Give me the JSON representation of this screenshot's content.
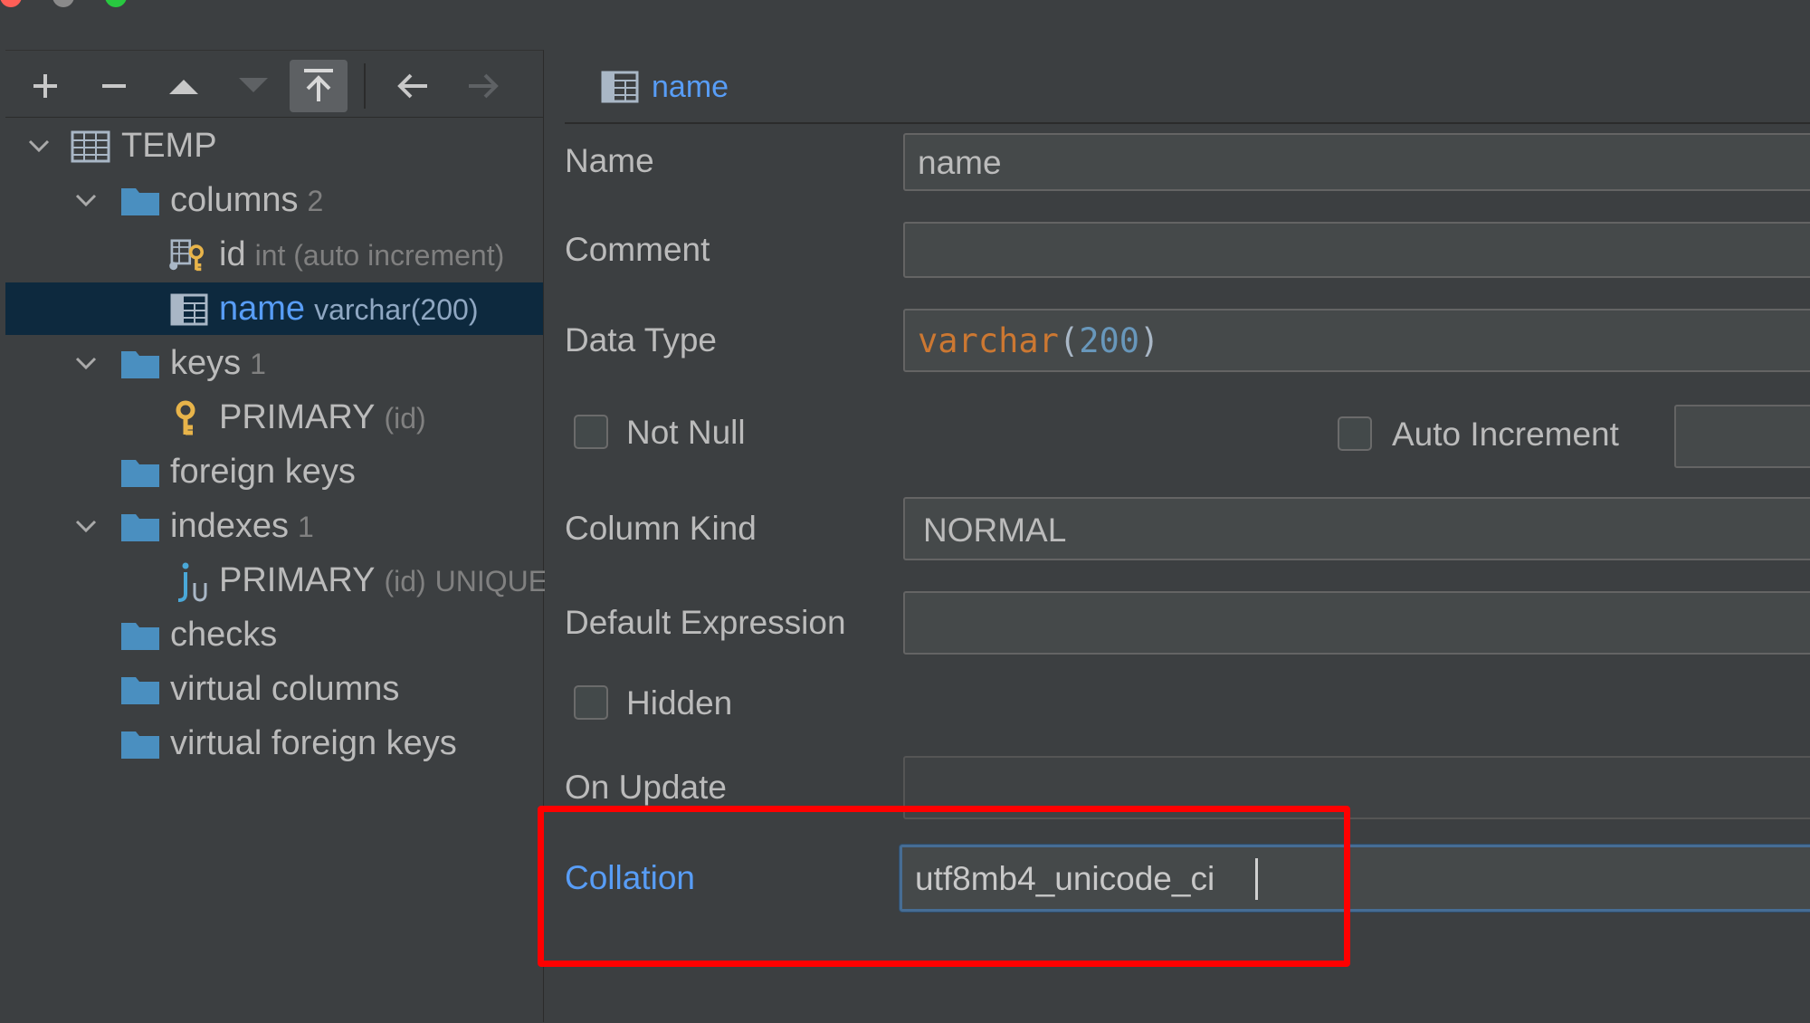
{
  "window": {
    "traffic_colors": {
      "close": "#ff5f57",
      "minimize": "#8a8a8a",
      "maximize": "#28c840"
    }
  },
  "toolbar": {
    "icons": [
      "add-icon",
      "remove-icon",
      "move-up-icon",
      "move-down-icon",
      "pin-icon",
      "back-icon",
      "forward-icon"
    ]
  },
  "tree": {
    "table": {
      "label": "TEMP"
    },
    "columns": {
      "label": "columns",
      "count": "2"
    },
    "col_id": {
      "label": "id",
      "detail": "int (auto increment)"
    },
    "col_name": {
      "label": "name",
      "detail": "varchar(200)"
    },
    "keys": {
      "label": "keys",
      "count": "1"
    },
    "key_primary": {
      "label": "PRIMARY",
      "detail": "(id)"
    },
    "foreign_keys": {
      "label": "foreign keys"
    },
    "indexes": {
      "label": "indexes",
      "count": "1"
    },
    "index_primary": {
      "label": "PRIMARY",
      "detail": "(id)",
      "extra": "UNIQUE"
    },
    "checks": {
      "label": "checks"
    },
    "virtual_columns": {
      "label": "virtual columns"
    },
    "virtual_foreign_keys": {
      "label": "virtual foreign keys"
    }
  },
  "editor": {
    "breadcrumb": "name",
    "name": {
      "label": "Name",
      "value": "name"
    },
    "comment": {
      "label": "Comment",
      "value": ""
    },
    "data_type": {
      "label": "Data Type",
      "type_name": "varchar",
      "open": "(",
      "size": "200",
      "close": ")"
    },
    "not_null": {
      "label": "Not Null",
      "checked": false
    },
    "auto_increment": {
      "label": "Auto Increment",
      "checked": false
    },
    "column_kind": {
      "label": "Column Kind",
      "value": "NORMAL"
    },
    "default_expression": {
      "label": "Default Expression",
      "value": ""
    },
    "hidden": {
      "label": "Hidden",
      "checked": false
    },
    "on_update": {
      "label": "On Update",
      "value": ""
    },
    "collation": {
      "label": "Collation",
      "value": "utf8mb4_unicode_ci"
    }
  },
  "colors": {
    "highlight_box": "#ff0000",
    "selection_bg": "#0d293e",
    "accent_blue": "#589df6",
    "keyword_orange": "#cc7832",
    "number_blue": "#6897bb",
    "folder_blue": "#4a8fc0",
    "key_gold": "#e8b44a"
  }
}
